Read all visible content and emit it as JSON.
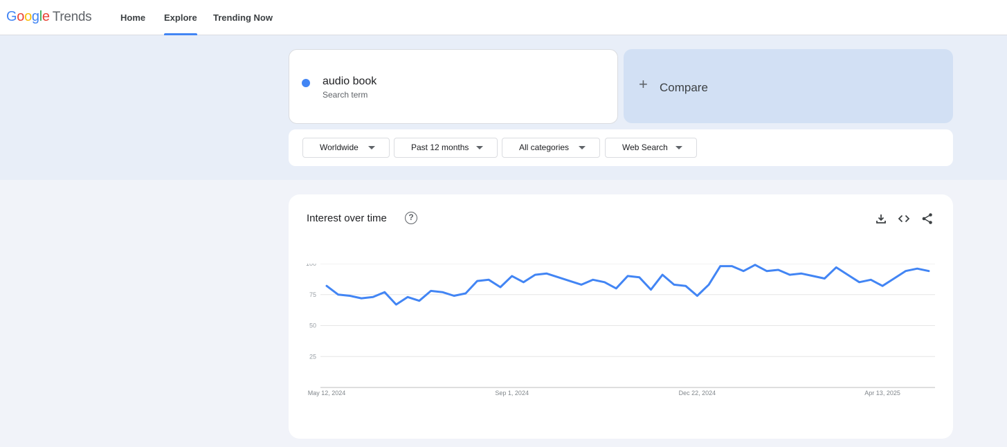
{
  "header": {
    "logo_google": [
      "G",
      "o",
      "o",
      "g",
      "l",
      "e"
    ],
    "logo_product": "Trends",
    "nav": [
      {
        "label": "Home",
        "active": false
      },
      {
        "label": "Explore",
        "active": true
      },
      {
        "label": "Trending Now",
        "active": false
      }
    ]
  },
  "search": {
    "term": "audio book",
    "term_type": "Search term",
    "term_color": "#4285f4",
    "compare_label": "Compare"
  },
  "filters": {
    "location": "Worldwide",
    "time_range": "Past 12 months",
    "category": "All categories",
    "property": "Web Search"
  },
  "panel": {
    "title": "Interest over time",
    "actions": [
      "download-icon",
      "embed-code-icon",
      "share-icon"
    ]
  },
  "colors": {
    "accent": "#4285f4",
    "compare_bg": "#d2e0f4"
  },
  "chart_data": {
    "type": "line",
    "x": [
      "2024-05-12",
      "2024-05-19",
      "2024-05-26",
      "2024-06-02",
      "2024-06-09",
      "2024-06-16",
      "2024-06-23",
      "2024-06-30",
      "2024-07-07",
      "2024-07-14",
      "2024-07-21",
      "2024-07-28",
      "2024-08-04",
      "2024-08-11",
      "2024-08-18",
      "2024-08-25",
      "2024-09-01",
      "2024-09-08",
      "2024-09-15",
      "2024-09-22",
      "2024-09-29",
      "2024-10-06",
      "2024-10-13",
      "2024-10-20",
      "2024-10-27",
      "2024-11-03",
      "2024-11-10",
      "2024-11-17",
      "2024-11-24",
      "2024-12-01",
      "2024-12-08",
      "2024-12-15",
      "2024-12-22",
      "2024-12-29",
      "2025-01-05",
      "2025-01-12",
      "2025-01-19",
      "2025-01-26",
      "2025-02-02",
      "2025-02-09",
      "2025-02-16",
      "2025-02-23",
      "2025-03-02",
      "2025-03-09",
      "2025-03-16",
      "2025-03-23",
      "2025-03-30",
      "2025-04-06",
      "2025-04-13",
      "2025-04-20",
      "2025-04-27",
      "2025-05-04",
      "2025-05-11"
    ],
    "series": [
      {
        "values": [
          82,
          75,
          74,
          72,
          73,
          77,
          67,
          73,
          70,
          78,
          77,
          74,
          76,
          86,
          87,
          81,
          90,
          85,
          91,
          92,
          89,
          86,
          83,
          87,
          85,
          80,
          90,
          89,
          79,
          91,
          83,
          82,
          74,
          83,
          98,
          98,
          94,
          99,
          94,
          95,
          91,
          92,
          90,
          88,
          97,
          91,
          85,
          87,
          82,
          88,
          94,
          96,
          94
        ]
      }
    ],
    "x_tick_labels": [
      "May 12, 2024",
      "Sep 1, 2024",
      "Dec 22, 2024",
      "Apr 13, 2025"
    ],
    "y_ticks": [
      25,
      50,
      75,
      100
    ],
    "ylim": [
      0,
      100
    ],
    "grid": true
  }
}
